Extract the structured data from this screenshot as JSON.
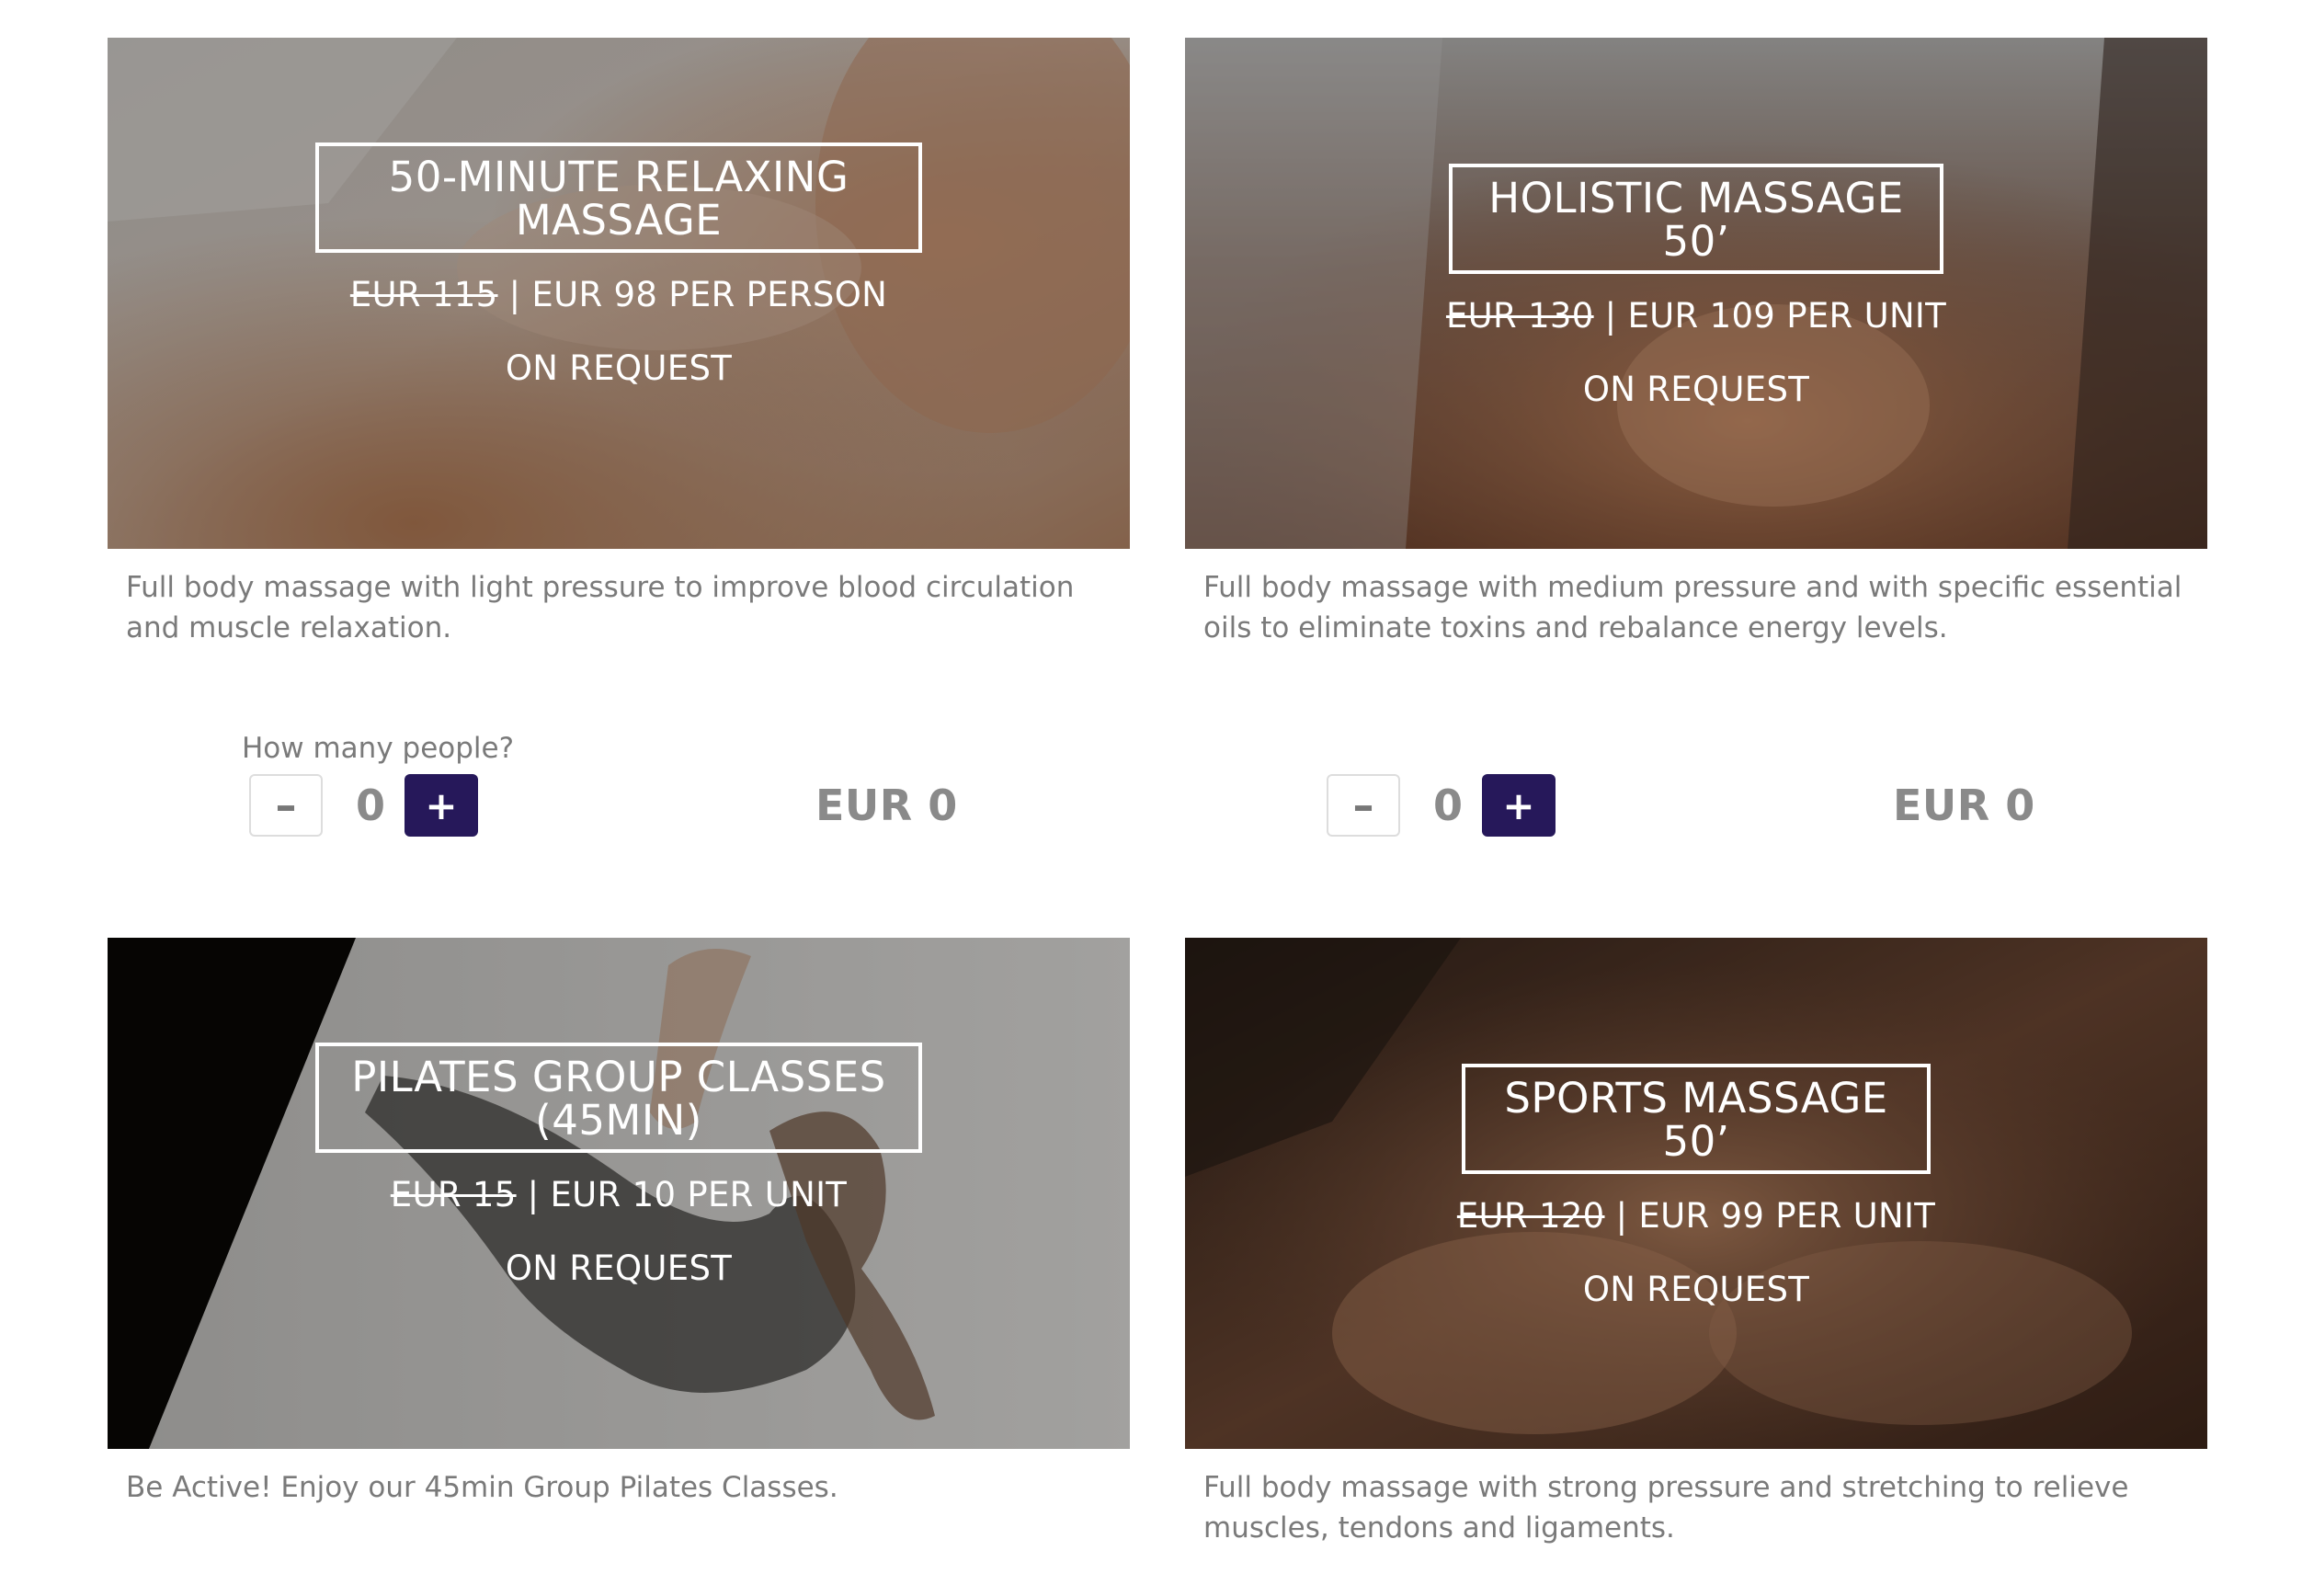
{
  "accent_color": "#26185a",
  "cards": [
    {
      "title": "50-MINUTE RELAXING MASSAGE",
      "old_price": "EUR 115",
      "separator": " | ",
      "new_price": "EUR 98 PER PERSON",
      "availability": "ON REQUEST",
      "description": "Full body massage with light pressure to improve blood circulation and muscle relaxation.",
      "quantity_label": "How many people?",
      "quantity": "0",
      "total": "EUR 0",
      "minus_label": "–",
      "plus_label": "+"
    },
    {
      "title": "HOLISTIC MASSAGE 50’",
      "old_price": "EUR 130",
      "separator": " | ",
      "new_price": "EUR 109 PER UNIT",
      "availability": "ON REQUEST",
      "description": "Full body massage with medium pressure and with specific essential oils to eliminate toxins and rebalance energy levels.",
      "quantity": "0",
      "total": "EUR 0",
      "minus_label": "–",
      "plus_label": "+"
    },
    {
      "title": "PILATES GROUP CLASSES (45MIN)",
      "old_price": "EUR 15",
      "separator": " | ",
      "new_price": "EUR 10 PER UNIT",
      "availability": "ON REQUEST",
      "description": "Be Active! Enjoy our 45min Group Pilates Classes."
    },
    {
      "title": "SPORTS MASSAGE 50’",
      "old_price": "EUR 120",
      "separator": " | ",
      "new_price": "EUR 99 PER UNIT",
      "availability": "ON REQUEST",
      "description": "Full body massage with strong pressure and stretching to relieve muscles, tendons and ligaments."
    }
  ]
}
